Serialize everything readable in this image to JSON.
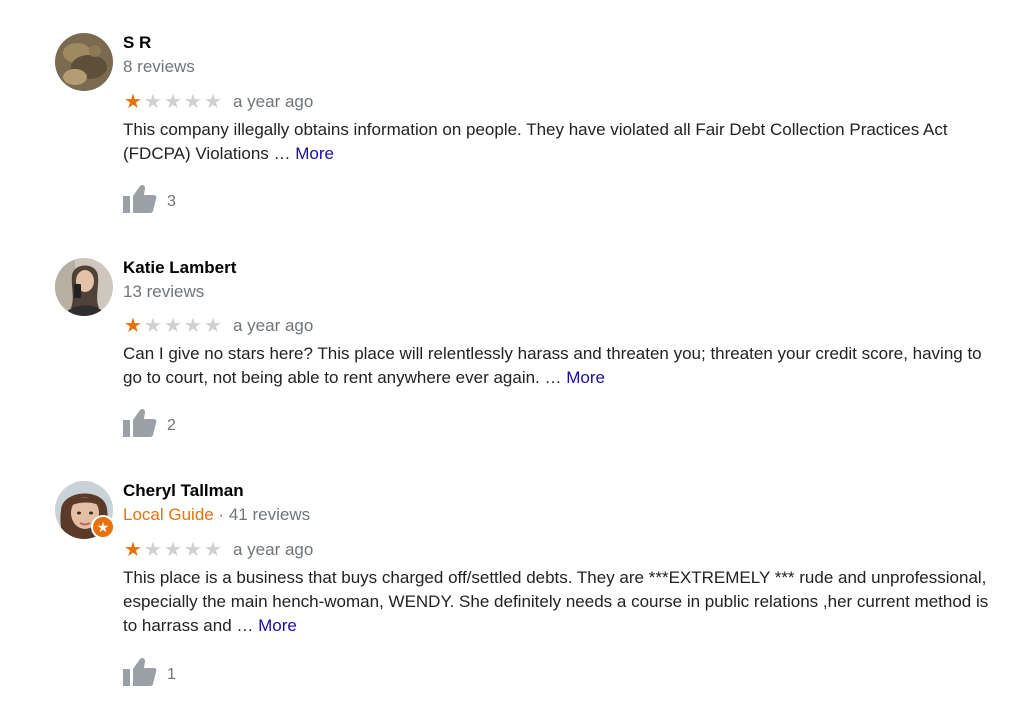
{
  "reviews": [
    {
      "name": "S R",
      "guide": "",
      "separator": "",
      "review_count": "8 reviews",
      "time": "a year ago",
      "rating": 1,
      "text": "This company illegally obtains information on people. They have violated all Fair Debt Collection Practices Act (FDCPA) Violations … ",
      "more": "More",
      "likes": "3",
      "avatar_icon": "user-photo-icon"
    },
    {
      "name": "Katie Lambert",
      "guide": "",
      "separator": "",
      "review_count": "13 reviews",
      "time": "a year ago",
      "rating": 1,
      "text": "Can I give no stars here? This place will relentlessly harass and threaten you; threaten your credit score, having to go to court, not being able to rent anywhere ever again. … ",
      "more": "More",
      "likes": "2",
      "avatar_icon": "user-photo-icon"
    },
    {
      "name": "Cheryl Tallman",
      "guide": "Local Guide",
      "separator": " · ",
      "review_count": "41 reviews",
      "time": "a year ago",
      "rating": 1,
      "text": "This place is a business that buys charged off/settled debts. They are ***EXTREMELY *** rude and unprofessional, especially the main hench-woman, WENDY. She definitely needs a course in public relations ,her current method is to harrass and … ",
      "more": "More",
      "likes": "1",
      "avatar_icon": "user-photo-icon"
    }
  ],
  "colors": {
    "star_on": "#e8710a",
    "star_off": "#d0d0d0",
    "link": "#1a0dab",
    "muted": "#70757a",
    "guide": "#e8710a"
  },
  "icons": {
    "star": "star-icon",
    "like": "thumbs-up-icon",
    "badge": "local-guide-badge-icon"
  }
}
